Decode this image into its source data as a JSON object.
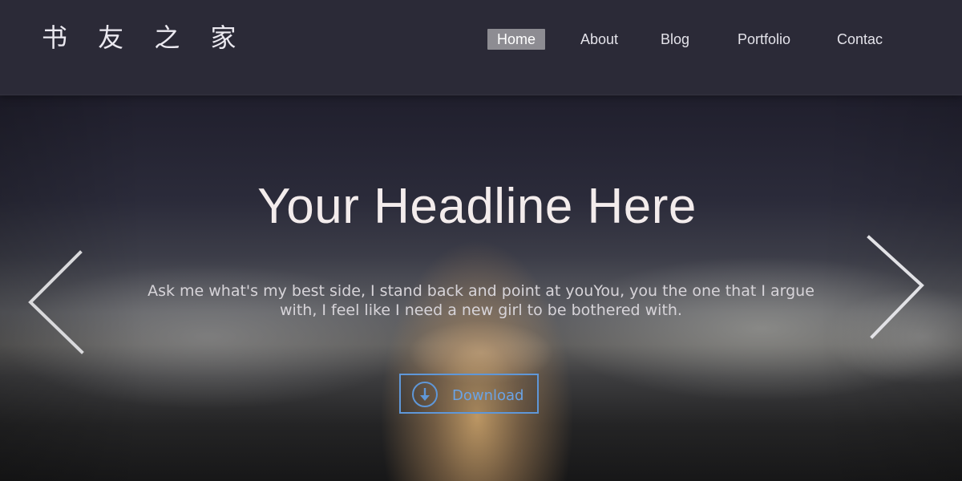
{
  "header": {
    "logo": "书 友 之 家",
    "nav": [
      {
        "label": "Home",
        "active": true
      },
      {
        "label": "About",
        "active": false
      },
      {
        "label": "Blog",
        "active": false
      },
      {
        "label": "Portfolio",
        "active": false
      },
      {
        "label": "Contac",
        "active": false
      }
    ]
  },
  "hero": {
    "headline": "Your Headline Here",
    "subtext": "Ask me what's my best side, I stand back and point at youYou, you the one that I argue with, I feel like I need a new girl to be bothered with.",
    "download_label": "Download",
    "download_icon": "download-arrow-icon",
    "prev_icon": "chevron-left-icon",
    "next_icon": "chevron-right-icon"
  },
  "colors": {
    "header_bg": "#2b2a37",
    "nav_active_bg": "#8d8c92",
    "accent_blue": "#5f97d8",
    "headline": "#f3ecec"
  }
}
